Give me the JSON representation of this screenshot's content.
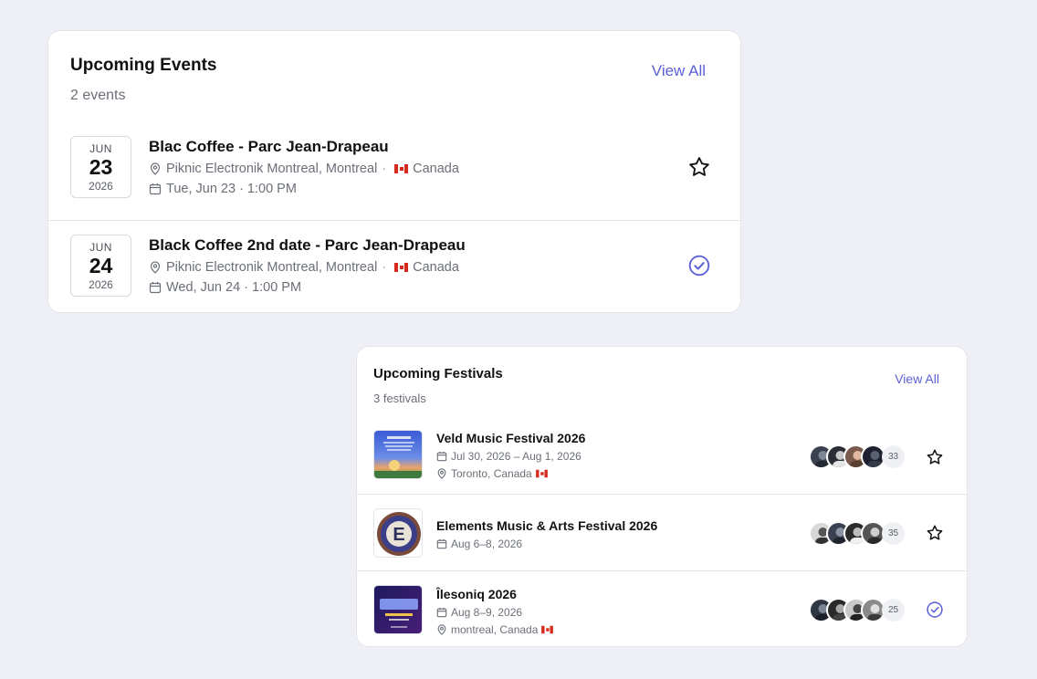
{
  "events": {
    "title": "Upcoming Events",
    "subtitle": "2 events",
    "view_all": "View All",
    "items": [
      {
        "month": "JUN",
        "day": "23",
        "year": "2026",
        "name": "Blac Coffee - Parc Jean-Drapeau",
        "venue": "Piknic Electronik Montreal, Montreal",
        "country": "Canada",
        "datetime": "Tue, Jun 23 · 1:00 PM",
        "action": "star-icon"
      },
      {
        "month": "JUN",
        "day": "24",
        "year": "2026",
        "name": "Black Coffee 2nd date - Parc Jean-Drapeau",
        "venue": "Piknic Electronik Montreal, Montreal",
        "country": "Canada",
        "datetime": "Wed, Jun 24 · 1:00 PM",
        "action": "check-circle-icon"
      }
    ]
  },
  "festivals": {
    "title": "Upcoming Festivals",
    "subtitle": "3 festivals",
    "view_all": "View All",
    "items": [
      {
        "name": "Veld Music Festival 2026",
        "dates": "Jul 30, 2026 – Aug 1, 2026",
        "location": "Toronto, Canada",
        "count": "33",
        "action": "star-icon"
      },
      {
        "name": "Elements Music & Arts Festival 2026",
        "dates": "Aug 6–8, 2026",
        "count": "35",
        "action": "star-icon"
      },
      {
        "name": "Îlesoniq 2026",
        "dates": "Aug 8–9, 2026",
        "location": "montreal, Canada",
        "count": "25",
        "action": "check-circle-icon"
      }
    ]
  },
  "colors": {
    "accent": "#5b5fd6",
    "background": "#eef0f5",
    "flag_red": "#d52b1e"
  }
}
